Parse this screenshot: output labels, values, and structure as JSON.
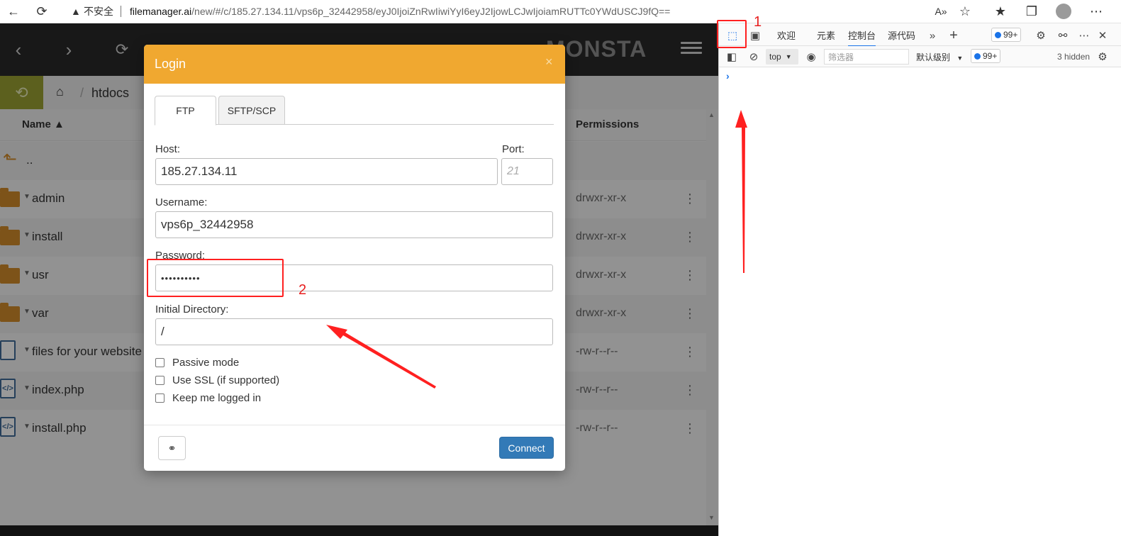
{
  "browser": {
    "security_label": "不安全",
    "url_host": "filemanager.ai",
    "url_path": "/new/#/c/185.27.134.11/vps6p_32442958/eyJ0IjoiZnRwIiwiYyI6eyJ2IjowLCJwIjoiamRUTTc0YWdUSCJ9fQ=="
  },
  "app": {
    "logo": "MONSTA",
    "breadcrumb": {
      "current_dir": "htdocs"
    },
    "list_header": {
      "name": "Name ▲",
      "permissions": "Permissions"
    },
    "files": [
      {
        "name": "..",
        "type": "up",
        "perm": ""
      },
      {
        "name": "admin",
        "type": "folder",
        "perm": "drwxr-xr-x"
      },
      {
        "name": "install",
        "type": "folder",
        "perm": "drwxr-xr-x"
      },
      {
        "name": "usr",
        "type": "folder",
        "perm": "drwxr-xr-x"
      },
      {
        "name": "var",
        "type": "folder",
        "perm": "drwxr-xr-x"
      },
      {
        "name": "files for your website",
        "type": "file",
        "perm": "-rw-r--r--"
      },
      {
        "name": "index.php",
        "type": "code",
        "perm": "-rw-r--r--"
      },
      {
        "name": "install.php",
        "type": "code",
        "perm": "-rw-r--r--"
      }
    ]
  },
  "modal": {
    "title": "Login",
    "close": "×",
    "tabs": [
      "FTP",
      "SFTP/SCP"
    ],
    "host_label": "Host:",
    "host_value": "185.27.134.11",
    "port_label": "Port:",
    "port_placeholder": "21",
    "username_label": "Username:",
    "username_value": "vps6p_32442958",
    "password_label": "Password:",
    "password_value": "••••••••••",
    "initial_dir_label": "Initial Directory:",
    "initial_dir_value": "/",
    "options": [
      "Passive mode",
      "Use SSL (if supported)",
      "Keep me logged in"
    ],
    "connect": "Connect"
  },
  "devtools": {
    "tabs": [
      "欢迎",
      "元素",
      "控制台",
      "源代码"
    ],
    "issues_badge": "99+",
    "context": "top",
    "filter_placeholder": "筛选器",
    "level": "默认级别",
    "hidden": "3 hidden",
    "prompt": "›"
  },
  "annotations": {
    "label_1": "1",
    "label_2": "2",
    "color": "#ff2020"
  }
}
